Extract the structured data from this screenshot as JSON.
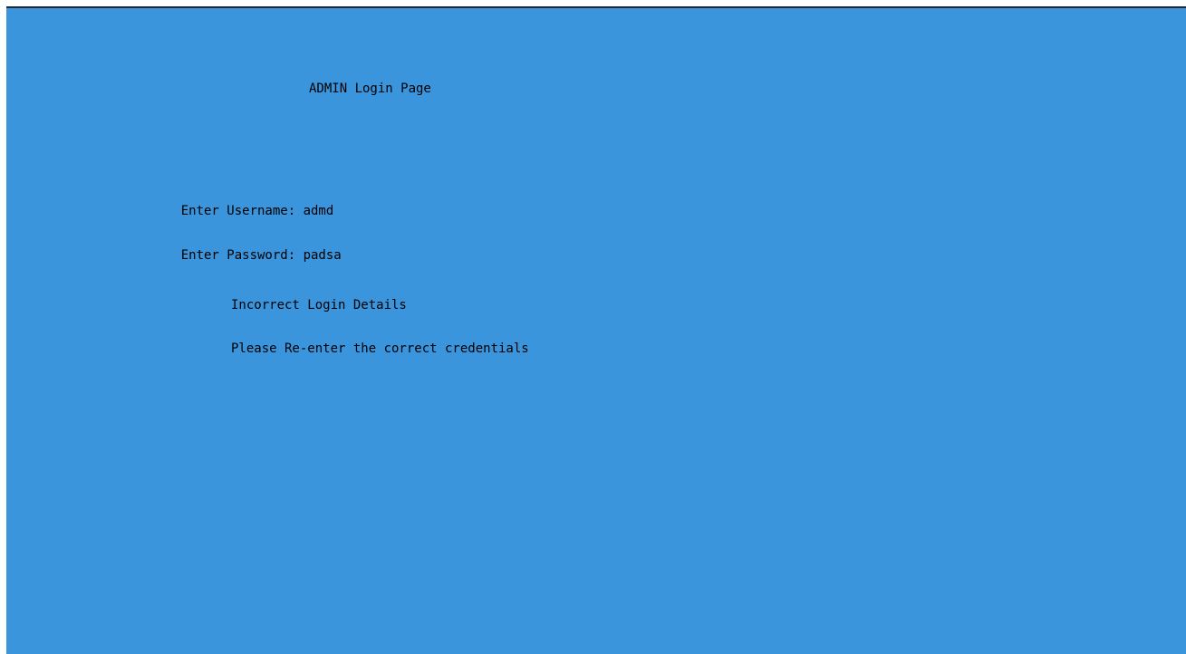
{
  "screen": {
    "title": "ADMIN Login Page",
    "username_label": "Enter Username: ",
    "username_value": "admd",
    "password_label": "Enter Password: ",
    "password_value": "padsa",
    "error_title": "Incorrect Login Details",
    "error_message": "Please Re-enter the correct credentials"
  },
  "colors": {
    "background": "#3b95dd",
    "text": "#000000"
  }
}
